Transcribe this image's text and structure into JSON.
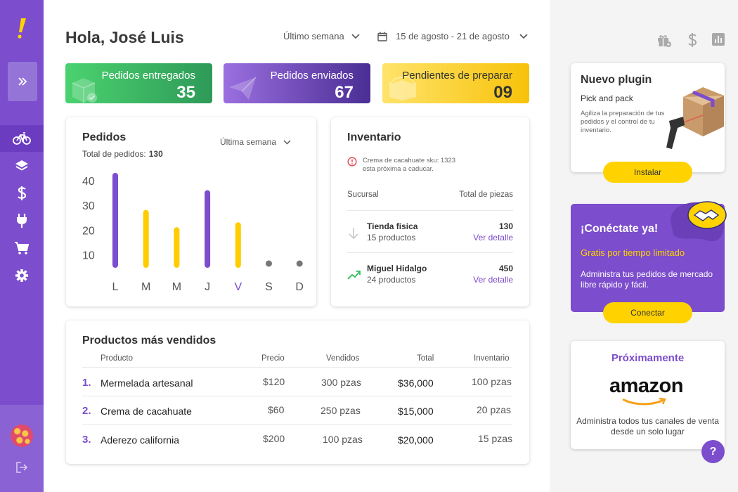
{
  "greeting": "Hola, José Luis",
  "filters": {
    "period": "Último semana",
    "date_range": "15 de agosto - 21 de agosto"
  },
  "stats": [
    {
      "label": "Pedidos entregados",
      "value": "35"
    },
    {
      "label": "Pedidos enviados",
      "value": "67"
    },
    {
      "label": "Pendientes de preparar",
      "value": "09"
    }
  ],
  "orders": {
    "title": "Pedidos",
    "total_label": "Total de pedidos:",
    "total_value": "130",
    "range": "Última semana"
  },
  "chart_data": {
    "type": "bar",
    "categories": [
      "L",
      "M",
      "M",
      "J",
      "V",
      "S",
      "D"
    ],
    "values": [
      42,
      27,
      20,
      35,
      22,
      0,
      0
    ],
    "colors": [
      "#7c4dcc",
      "#ffcc00",
      "#ffcc00",
      "#7c4dcc",
      "#ffcc00",
      "#777777",
      "#777777"
    ],
    "highlight_category_index": 4,
    "yticks": [
      10,
      20,
      30,
      40
    ],
    "ylim": [
      5,
      42
    ],
    "title": "",
    "xlabel": "",
    "ylabel": ""
  },
  "inventory": {
    "title": "Inventario",
    "alert": [
      "Crema de cacahuate sku: 1323",
      "esta próxima a caducar."
    ],
    "col_branch": "Sucursal",
    "col_pieces": "Total de piezas",
    "rows": [
      {
        "name": "Tienda fisica",
        "sub": "15 productos",
        "qty": "130",
        "link": "Ver detalle",
        "trend": "down"
      },
      {
        "name": "Miguel Hidalgo",
        "sub": "24 productos",
        "qty": "450",
        "link": "Ver detalle",
        "trend": "up"
      }
    ]
  },
  "products": {
    "title": "Productos más vendidos",
    "headers": [
      "Producto",
      "Precio",
      "Vendidos",
      "Total",
      "Inventario"
    ],
    "rows": [
      {
        "num": "1.",
        "name": "Mermelada artesanal",
        "price": "$120",
        "sold": "300 pzas",
        "total": "$36,000",
        "stock": "100 pzas"
      },
      {
        "num": "2.",
        "name": "Crema de cacahuate",
        "price": "$60",
        "sold": "250 pzas",
        "total": "$15,000",
        "stock": "20 pzas"
      },
      {
        "num": "3.",
        "name": "Aderezo california",
        "price": "$200",
        "sold": "100 pzas",
        "total": "$20,000",
        "stock": "15 pzas"
      }
    ]
  },
  "plugin": {
    "title": "Nuevo plugin",
    "subtitle": "Pick and pack",
    "desc": "Agiliza la preparación de tus pedidos y el control de tu inventario.",
    "button": "Instalar"
  },
  "connect": {
    "title": "¡Conéctate ya!",
    "promo": "Gratis por tiempo limitado",
    "desc": "Administra tus pedidos de mercado libre rápido y fácil.",
    "button": "Conectar"
  },
  "soon": {
    "title": "Próximamente",
    "brand": "amazon",
    "desc": "Administra todos tus canales de venta desde un solo lugar"
  },
  "help": "?",
  "icons": {
    "nav": [
      "bike-icon",
      "layers-icon",
      "dollar-icon",
      "plug-icon",
      "cart-icon",
      "gear-icon"
    ],
    "top": [
      "gift-icon",
      "dollar-icon",
      "chart-icon"
    ]
  }
}
